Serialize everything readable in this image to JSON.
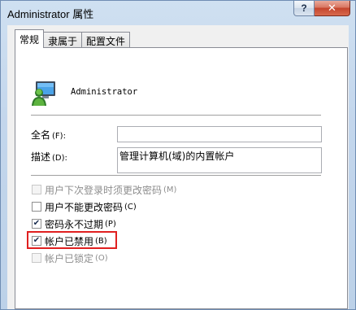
{
  "window": {
    "title": "Administrator 属性",
    "help_label": "?",
    "close_label": "✕"
  },
  "tabs": [
    {
      "label": "常规",
      "active": true
    },
    {
      "label": "隶属于",
      "active": false
    },
    {
      "label": "配置文件",
      "active": false
    }
  ],
  "general": {
    "user_name": "Administrator",
    "full_name": {
      "label": "全名",
      "accel": "(F):",
      "value": ""
    },
    "description": {
      "label": "描述",
      "accel": "(D):",
      "value": "管理计算机(域)的内置帐户"
    },
    "checkboxes": [
      {
        "label": "用户下次登录时须更改密码",
        "accel": "(M)",
        "checked": false,
        "enabled": false
      },
      {
        "label": "用户不能更改密码",
        "accel": "(C)",
        "checked": false,
        "enabled": true
      },
      {
        "label": "密码永不过期",
        "accel": "(P)",
        "checked": true,
        "enabled": true
      },
      {
        "label": "帐户已禁用",
        "accel": "(B)",
        "checked": true,
        "enabled": true
      },
      {
        "label": "帐户已锁定",
        "accel": "(O)",
        "checked": false,
        "enabled": false
      }
    ]
  },
  "colors": {
    "highlight_border": "#e02020"
  },
  "icons": {
    "user": "user-icon"
  }
}
